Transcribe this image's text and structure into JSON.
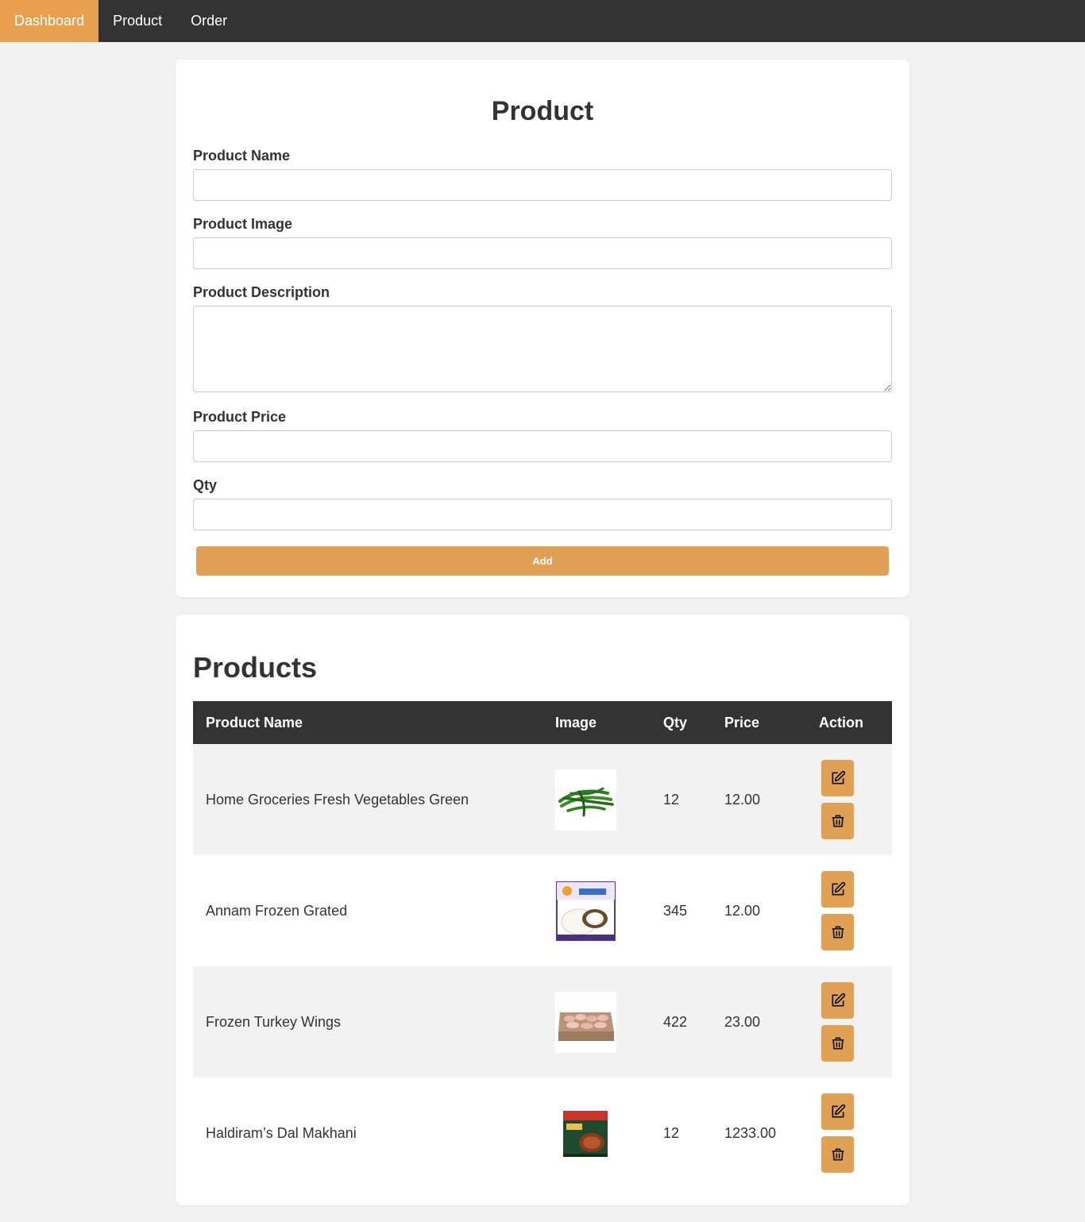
{
  "nav": {
    "items": [
      {
        "label": "Dashboard",
        "active": true
      },
      {
        "label": "Product",
        "active": false
      },
      {
        "label": "Order",
        "active": false
      }
    ]
  },
  "form": {
    "title": "Product",
    "fields": {
      "name_label": "Product Name",
      "name_value": "",
      "image_label": "Product Image",
      "image_value": "",
      "description_label": "Product Description",
      "description_value": "",
      "price_label": "Product Price",
      "price_value": "",
      "qty_label": "Qty",
      "qty_value": ""
    },
    "submit_label": "Add"
  },
  "products": {
    "title": "Products",
    "columns": [
      "Product Name",
      "Image",
      "Qty",
      "Price",
      "Action"
    ],
    "rows": [
      {
        "name": "Home Groceries Fresh Vegetables Green",
        "qty": "12",
        "price": "12.00",
        "image_icon": "green-chilli-image"
      },
      {
        "name": "Annam Frozen Grated",
        "qty": "345",
        "price": "12.00",
        "image_icon": "grated-coconut-pack-image"
      },
      {
        "name": "Frozen Turkey Wings",
        "qty": "422",
        "price": "23.00",
        "image_icon": "turkey-wings-box-image"
      },
      {
        "name": "Haldiram’s Dal Makhani",
        "qty": "12",
        "price": "1233.00",
        "image_icon": "dal-makhani-pack-image"
      }
    ],
    "actions": {
      "edit_icon": "edit-icon",
      "delete_icon": "trash-icon"
    }
  },
  "colors": {
    "nav_bg": "#333333",
    "accent": "#e8a04e",
    "button": "#e0a055",
    "page_bg": "#f2f2f2"
  }
}
